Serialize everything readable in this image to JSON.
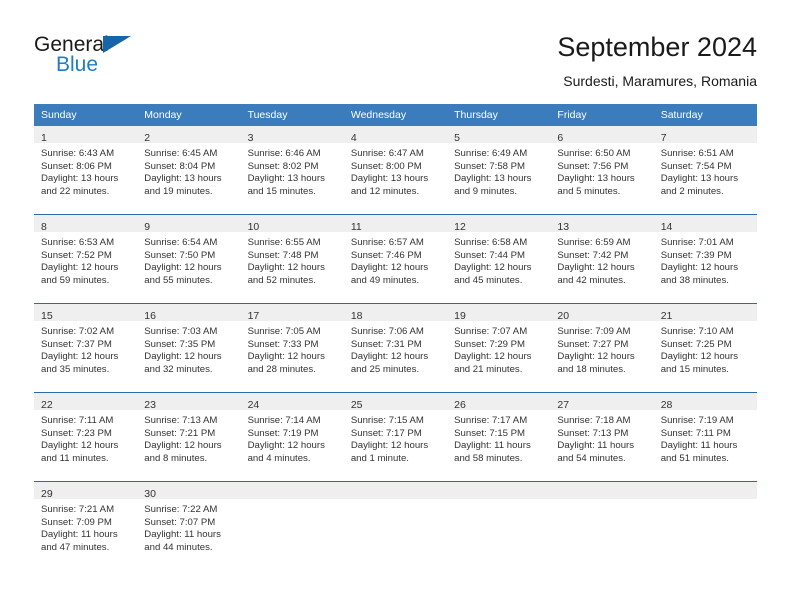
{
  "brand": {
    "name_part1": "General",
    "name_part2": "Blue",
    "logo_icon": "triangle-flag-icon",
    "color_primary": "#1f7ec2",
    "color_triangle": "#1565a8"
  },
  "header": {
    "title": "September 2024",
    "subtitle": "Surdesti, Maramures, Romania"
  },
  "theme": {
    "header_row_bg": "#3b7cbd",
    "daynum_band_bg": "#efefef",
    "row_divider": "#2b6ca8",
    "text": "#333333"
  },
  "weekday_headers": [
    "Sunday",
    "Monday",
    "Tuesday",
    "Wednesday",
    "Thursday",
    "Friday",
    "Saturday"
  ],
  "weeks": [
    [
      {
        "day": "1",
        "sunrise": "Sunrise: 6:43 AM",
        "sunset": "Sunset: 8:06 PM",
        "daylight_line1": "Daylight: 13 hours",
        "daylight_line2": "and 22 minutes."
      },
      {
        "day": "2",
        "sunrise": "Sunrise: 6:45 AM",
        "sunset": "Sunset: 8:04 PM",
        "daylight_line1": "Daylight: 13 hours",
        "daylight_line2": "and 19 minutes."
      },
      {
        "day": "3",
        "sunrise": "Sunrise: 6:46 AM",
        "sunset": "Sunset: 8:02 PM",
        "daylight_line1": "Daylight: 13 hours",
        "daylight_line2": "and 15 minutes."
      },
      {
        "day": "4",
        "sunrise": "Sunrise: 6:47 AM",
        "sunset": "Sunset: 8:00 PM",
        "daylight_line1": "Daylight: 13 hours",
        "daylight_line2": "and 12 minutes."
      },
      {
        "day": "5",
        "sunrise": "Sunrise: 6:49 AM",
        "sunset": "Sunset: 7:58 PM",
        "daylight_line1": "Daylight: 13 hours",
        "daylight_line2": "and 9 minutes."
      },
      {
        "day": "6",
        "sunrise": "Sunrise: 6:50 AM",
        "sunset": "Sunset: 7:56 PM",
        "daylight_line1": "Daylight: 13 hours",
        "daylight_line2": "and 5 minutes."
      },
      {
        "day": "7",
        "sunrise": "Sunrise: 6:51 AM",
        "sunset": "Sunset: 7:54 PM",
        "daylight_line1": "Daylight: 13 hours",
        "daylight_line2": "and 2 minutes."
      }
    ],
    [
      {
        "day": "8",
        "sunrise": "Sunrise: 6:53 AM",
        "sunset": "Sunset: 7:52 PM",
        "daylight_line1": "Daylight: 12 hours",
        "daylight_line2": "and 59 minutes."
      },
      {
        "day": "9",
        "sunrise": "Sunrise: 6:54 AM",
        "sunset": "Sunset: 7:50 PM",
        "daylight_line1": "Daylight: 12 hours",
        "daylight_line2": "and 55 minutes."
      },
      {
        "day": "10",
        "sunrise": "Sunrise: 6:55 AM",
        "sunset": "Sunset: 7:48 PM",
        "daylight_line1": "Daylight: 12 hours",
        "daylight_line2": "and 52 minutes."
      },
      {
        "day": "11",
        "sunrise": "Sunrise: 6:57 AM",
        "sunset": "Sunset: 7:46 PM",
        "daylight_line1": "Daylight: 12 hours",
        "daylight_line2": "and 49 minutes."
      },
      {
        "day": "12",
        "sunrise": "Sunrise: 6:58 AM",
        "sunset": "Sunset: 7:44 PM",
        "daylight_line1": "Daylight: 12 hours",
        "daylight_line2": "and 45 minutes."
      },
      {
        "day": "13",
        "sunrise": "Sunrise: 6:59 AM",
        "sunset": "Sunset: 7:42 PM",
        "daylight_line1": "Daylight: 12 hours",
        "daylight_line2": "and 42 minutes."
      },
      {
        "day": "14",
        "sunrise": "Sunrise: 7:01 AM",
        "sunset": "Sunset: 7:39 PM",
        "daylight_line1": "Daylight: 12 hours",
        "daylight_line2": "and 38 minutes."
      }
    ],
    [
      {
        "day": "15",
        "sunrise": "Sunrise: 7:02 AM",
        "sunset": "Sunset: 7:37 PM",
        "daylight_line1": "Daylight: 12 hours",
        "daylight_line2": "and 35 minutes."
      },
      {
        "day": "16",
        "sunrise": "Sunrise: 7:03 AM",
        "sunset": "Sunset: 7:35 PM",
        "daylight_line1": "Daylight: 12 hours",
        "daylight_line2": "and 32 minutes."
      },
      {
        "day": "17",
        "sunrise": "Sunrise: 7:05 AM",
        "sunset": "Sunset: 7:33 PM",
        "daylight_line1": "Daylight: 12 hours",
        "daylight_line2": "and 28 minutes."
      },
      {
        "day": "18",
        "sunrise": "Sunrise: 7:06 AM",
        "sunset": "Sunset: 7:31 PM",
        "daylight_line1": "Daylight: 12 hours",
        "daylight_line2": "and 25 minutes."
      },
      {
        "day": "19",
        "sunrise": "Sunrise: 7:07 AM",
        "sunset": "Sunset: 7:29 PM",
        "daylight_line1": "Daylight: 12 hours",
        "daylight_line2": "and 21 minutes."
      },
      {
        "day": "20",
        "sunrise": "Sunrise: 7:09 AM",
        "sunset": "Sunset: 7:27 PM",
        "daylight_line1": "Daylight: 12 hours",
        "daylight_line2": "and 18 minutes."
      },
      {
        "day": "21",
        "sunrise": "Sunrise: 7:10 AM",
        "sunset": "Sunset: 7:25 PM",
        "daylight_line1": "Daylight: 12 hours",
        "daylight_line2": "and 15 minutes."
      }
    ],
    [
      {
        "day": "22",
        "sunrise": "Sunrise: 7:11 AM",
        "sunset": "Sunset: 7:23 PM",
        "daylight_line1": "Daylight: 12 hours",
        "daylight_line2": "and 11 minutes."
      },
      {
        "day": "23",
        "sunrise": "Sunrise: 7:13 AM",
        "sunset": "Sunset: 7:21 PM",
        "daylight_line1": "Daylight: 12 hours",
        "daylight_line2": "and 8 minutes."
      },
      {
        "day": "24",
        "sunrise": "Sunrise: 7:14 AM",
        "sunset": "Sunset: 7:19 PM",
        "daylight_line1": "Daylight: 12 hours",
        "daylight_line2": "and 4 minutes."
      },
      {
        "day": "25",
        "sunrise": "Sunrise: 7:15 AM",
        "sunset": "Sunset: 7:17 PM",
        "daylight_line1": "Daylight: 12 hours",
        "daylight_line2": "and 1 minute."
      },
      {
        "day": "26",
        "sunrise": "Sunrise: 7:17 AM",
        "sunset": "Sunset: 7:15 PM",
        "daylight_line1": "Daylight: 11 hours",
        "daylight_line2": "and 58 minutes."
      },
      {
        "day": "27",
        "sunrise": "Sunrise: 7:18 AM",
        "sunset": "Sunset: 7:13 PM",
        "daylight_line1": "Daylight: 11 hours",
        "daylight_line2": "and 54 minutes."
      },
      {
        "day": "28",
        "sunrise": "Sunrise: 7:19 AM",
        "sunset": "Sunset: 7:11 PM",
        "daylight_line1": "Daylight: 11 hours",
        "daylight_line2": "and 51 minutes."
      }
    ],
    [
      {
        "day": "29",
        "sunrise": "Sunrise: 7:21 AM",
        "sunset": "Sunset: 7:09 PM",
        "daylight_line1": "Daylight: 11 hours",
        "daylight_line2": "and 47 minutes."
      },
      {
        "day": "30",
        "sunrise": "Sunrise: 7:22 AM",
        "sunset": "Sunset: 7:07 PM",
        "daylight_line1": "Daylight: 11 hours",
        "daylight_line2": "and 44 minutes."
      },
      {
        "day": "",
        "sunrise": "",
        "sunset": "",
        "daylight_line1": "",
        "daylight_line2": ""
      },
      {
        "day": "",
        "sunrise": "",
        "sunset": "",
        "daylight_line1": "",
        "daylight_line2": ""
      },
      {
        "day": "",
        "sunrise": "",
        "sunset": "",
        "daylight_line1": "",
        "daylight_line2": ""
      },
      {
        "day": "",
        "sunrise": "",
        "sunset": "",
        "daylight_line1": "",
        "daylight_line2": ""
      },
      {
        "day": "",
        "sunrise": "",
        "sunset": "",
        "daylight_line1": "",
        "daylight_line2": ""
      }
    ]
  ]
}
